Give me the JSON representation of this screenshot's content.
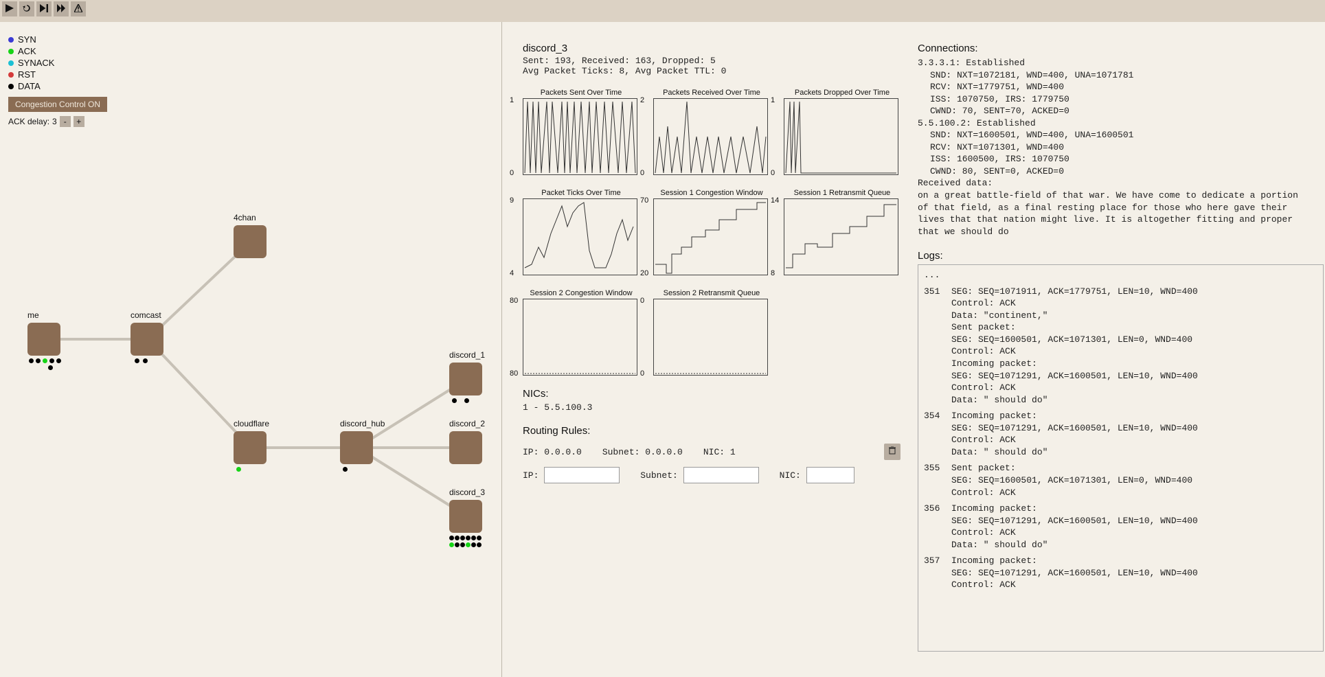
{
  "toolbar": {
    "play": "play-icon",
    "reset": "reset-icon",
    "step": "step-icon",
    "fast": "fast-forward-icon",
    "warn": "warn-icon"
  },
  "legend": {
    "items": [
      {
        "label": "SYN",
        "color": "#3b3bd4"
      },
      {
        "label": "ACK",
        "color": "#17d417"
      },
      {
        "label": "SYNACK",
        "color": "#1bc0d4"
      },
      {
        "label": "RST",
        "color": "#d43b3b"
      },
      {
        "label": "DATA",
        "color": "#000000"
      }
    ],
    "cc_label": "Congestion Control ON",
    "ack_delay_label": "ACK delay:",
    "ack_delay_value": "3",
    "minus": "-",
    "plus": "+"
  },
  "nodes": {
    "me": {
      "label": "me"
    },
    "comcast": {
      "label": "comcast"
    },
    "fourchan": {
      "label": "4chan"
    },
    "cloudflare": {
      "label": "cloudflare"
    },
    "discord_hub": {
      "label": "discord_hub"
    },
    "discord_1": {
      "label": "discord_1"
    },
    "discord_2": {
      "label": "discord_2"
    },
    "discord_3": {
      "label": "discord_3"
    }
  },
  "selected": {
    "title": "discord_3",
    "stats_line1": "Sent: 193, Received: 163, Dropped: 5",
    "stats_line2": "Avg Packet Ticks: 8, Avg Packet TTL: 0"
  },
  "charts": {
    "list": [
      {
        "title": "Packets Sent Over Time",
        "ymin": "0",
        "ymax": "1"
      },
      {
        "title": "Packets Received Over Time",
        "ymin": "0",
        "ymax": "2"
      },
      {
        "title": "Packets Dropped Over Time",
        "ymin": "0",
        "ymax": "1"
      },
      {
        "title": "Packet Ticks Over Time",
        "ymin": "4",
        "ymax": "9"
      },
      {
        "title": "Session 1 Congestion Window",
        "ymin": "20",
        "ymax": "70"
      },
      {
        "title": "Session 1 Retransmit Queue",
        "ymin": "8",
        "ymax": "14"
      },
      {
        "title": "Session 2 Congestion Window",
        "ymin": "80",
        "ymax": "80"
      },
      {
        "title": "Session 2 Retransmit Queue",
        "ymin": "0",
        "ymax": "0"
      }
    ]
  },
  "nics": {
    "heading": "NICs:",
    "line": "1 - 5.5.100.3"
  },
  "routing": {
    "heading": "Routing Rules:",
    "ip_label": "IP:",
    "ip_value": "0.0.0.0",
    "subnet_label": "Subnet:",
    "subnet_value": "0.0.0.0",
    "nic_label": "NIC:",
    "nic_value": "1"
  },
  "connections": {
    "heading": "Connections:",
    "c1_header": "3.3.3.1: Established",
    "c1_snd": "SND: NXT=1072181, WND=400, UNA=1071781",
    "c1_rcv": "RCV: NXT=1779751, WND=400",
    "c1_iss": "ISS: 1070750, IRS: 1779750",
    "c1_cwnd": "CWND: 70, SENT=70, ACKED=0",
    "c2_header": "5.5.100.2: Established",
    "c2_snd": "SND: NXT=1600501, WND=400, UNA=1600501",
    "c2_rcv": "RCV: NXT=1071301, WND=400",
    "c2_iss": "ISS: 1600500, IRS: 1070750",
    "c2_cwnd": "CWND: 80, SENT=0, ACKED=0",
    "recv_label": "Received data:",
    "recv_text": "on a great battle-field of that war. We have come to dedicate a portion of that field, as a final resting place for those who here gave their lives that that nation might live. It is altogether fitting and proper that we should do"
  },
  "logs": {
    "heading": "Logs:",
    "ellipsis": "...",
    "t351": "351",
    "t351_a": "SEG: SEQ=1071911, ACK=1779751, LEN=10, WND=400",
    "t351_b": "Control: ACK",
    "t351_c": "Data: \"continent,\"",
    "t351_d": "Sent packet:",
    "t351_e": "SEG: SEQ=1600501, ACK=1071301, LEN=0, WND=400",
    "t351_f": "Control: ACK",
    "t351_g": "Incoming packet:",
    "t351_h": "SEG: SEQ=1071291, ACK=1600501, LEN=10, WND=400",
    "t351_i": "Control: ACK",
    "t351_j": "Data: \" should do\"",
    "t354": "354",
    "t354_a": "Incoming packet:",
    "t354_b": "SEG: SEQ=1071291, ACK=1600501, LEN=10, WND=400",
    "t354_c": "Control: ACK",
    "t354_d": "Data: \" should do\"",
    "t355": "355",
    "t355_a": "Sent packet:",
    "t355_b": "SEG: SEQ=1600501, ACK=1071301, LEN=0, WND=400",
    "t355_c": "Control: ACK",
    "t356": "356",
    "t356_a": "Incoming packet:",
    "t356_b": "SEG: SEQ=1071291, ACK=1600501, LEN=10, WND=400",
    "t356_c": "Control: ACK",
    "t356_d": "Data: \" should do\"",
    "t357": "357",
    "t357_a": "Incoming packet:",
    "t357_b": "SEG: SEQ=1071291, ACK=1600501, LEN=10, WND=400",
    "t357_c": "Control: ACK"
  },
  "chart_data": [
    {
      "type": "line",
      "title": "Packets Sent Over Time",
      "ylim": [
        0,
        1
      ],
      "note": "binary 0/1 oscillation"
    },
    {
      "type": "line",
      "title": "Packets Received Over Time",
      "ylim": [
        0,
        2
      ],
      "note": "spikes between 0 and 2"
    },
    {
      "type": "line",
      "title": "Packets Dropped Over Time",
      "ylim": [
        0,
        1
      ],
      "note": "mostly 0 with a few 1 spikes early"
    },
    {
      "type": "line",
      "title": "Packet Ticks Over Time",
      "ylim": [
        4,
        9
      ],
      "note": "varies between roughly 4 and 9"
    },
    {
      "type": "line",
      "title": "Session 1 Congestion Window",
      "ylim": [
        20,
        70
      ],
      "note": "step-increase from ~20 to ~70"
    },
    {
      "type": "line",
      "title": "Session 1 Retransmit Queue",
      "ylim": [
        8,
        14
      ],
      "note": "step-increase from ~8 to ~14"
    },
    {
      "type": "line",
      "title": "Session 2 Congestion Window",
      "ylim": [
        80,
        80
      ],
      "note": "flat at 80"
    },
    {
      "type": "line",
      "title": "Session 2 Retransmit Queue",
      "ylim": [
        0,
        0
      ],
      "note": "flat at 0"
    }
  ]
}
